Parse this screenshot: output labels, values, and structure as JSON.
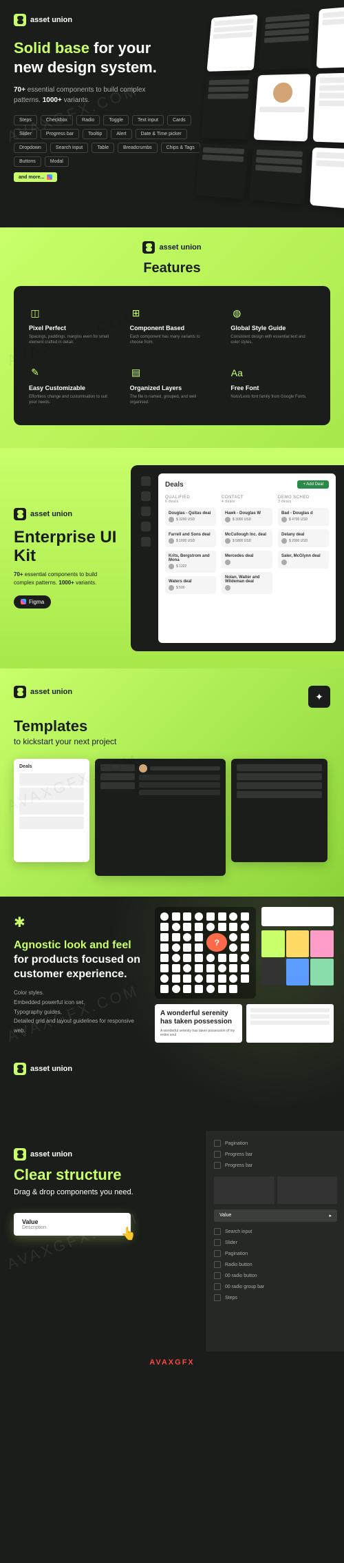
{
  "brand": "asset union",
  "watermark": "AVAXGFX.COM",
  "hero": {
    "title_accent": "Solid base",
    "title_rest": " for your new design system.",
    "sub_highlight1": "70+",
    "sub_text1": " essential components to build complex patterns. ",
    "sub_highlight2": "1000+",
    "sub_text2": " variants.",
    "tags": [
      "Steps",
      "Checkbox",
      "Radio",
      "Toggle",
      "Text input",
      "Cards",
      "Slider",
      "Progress bar",
      "Tooltip",
      "Alert",
      "Date & Time picker",
      "Dropdown",
      "Search input",
      "Table",
      "Breadcrumbs",
      "Chips & Tags",
      "Buttons",
      "Modal"
    ],
    "and_more": "and more..."
  },
  "features": {
    "title": "Features",
    "items": [
      {
        "icon": "◫",
        "name": "Pixel Perfect",
        "desc": "Spacings, paddings, margins even for small element crafted in detail."
      },
      {
        "icon": "⊞",
        "name": "Component Based",
        "desc": "Each component has many variants to choose from."
      },
      {
        "icon": "◍",
        "name": "Global Style Guide",
        "desc": "Consistent design with essential text and color styles."
      },
      {
        "icon": "✎",
        "name": "Easy Customizable",
        "desc": "Effortless change and customisation to suit your needs."
      },
      {
        "icon": "▤",
        "name": "Organized Layers",
        "desc": "The file is named, grouped, and well organised."
      },
      {
        "icon": "Aa",
        "name": "Free Font",
        "desc": "Noto/Lexis font family from Google Fonts."
      }
    ]
  },
  "enterprise": {
    "title": "Enterprise UI Kit",
    "sub_b1": "70+",
    "sub_t1": " essential components to build complex patterns. ",
    "sub_b2": "1000+",
    "sub_t2": " variants.",
    "figma": "Figma",
    "deals_title": "Deals",
    "add_deal": "+ Add Deal",
    "columns": [
      {
        "head": "QUALIFIED",
        "count": "6 deals",
        "deals": [
          {
            "name": "Douglas - Quitas deal",
            "amount": "$ 3200 USD"
          },
          {
            "name": "Farrell and Sons deal",
            "amount": "$ 1000 USD"
          },
          {
            "name": "Krits, Bergstrom and Mona",
            "amount": "$ 1222"
          },
          {
            "name": "Waters deal",
            "amount": "$ 500"
          }
        ]
      },
      {
        "head": "CONTACT",
        "count": "4 deals",
        "deals": [
          {
            "name": "Hawk - Douglas W",
            "amount": "$ 3000 USD"
          },
          {
            "name": "McCullough Inc. deal",
            "amount": "$ 5800 USD"
          },
          {
            "name": "Mercedes deal",
            "amount": ""
          },
          {
            "name": "Nolan, Walter and Wildeman deal",
            "amount": ""
          }
        ]
      },
      {
        "head": "DEMO SCHED",
        "count": "3 deals",
        "deals": [
          {
            "name": "Bad - Douglas d",
            "amount": "$ 4700 USD"
          },
          {
            "name": "Delany deal",
            "amount": "$ 2000 USD"
          },
          {
            "name": "Saler, McGlynn deal",
            "amount": ""
          }
        ]
      }
    ]
  },
  "templates": {
    "title": "Templates",
    "subtitle": "to kickstart your next project"
  },
  "agnostic": {
    "title_accent": "Agnostic look and feel",
    "title_rest": "for products focused on customer experience.",
    "bullets": [
      "Color styles.",
      "Embedded powerful icon set.",
      "Typography guides.",
      "Detailed grid and layout guidelines for responsive web."
    ],
    "typo_heading": "A wonderful serenity has taken possession",
    "typo_body": "A wonderful serenity has taken possession of my entire soul",
    "colors": [
      "#c8ff6a",
      "#ffd966",
      "#ff9cc8",
      "#333333",
      "#5a9cff",
      "#88ddaa"
    ]
  },
  "structure": {
    "title": "Clear structure",
    "subtitle": "Drag & drop components you need.",
    "drag_label": "Value",
    "drag_desc": "Description",
    "panel_items": [
      "Pagination",
      "Progress bar",
      "Progress bar"
    ],
    "panel_value": "Value",
    "panel_items2": [
      "Search input",
      "Slider",
      "Pagination",
      "Radio button",
      "00 radio button",
      "00 radio group bar",
      "Steps"
    ]
  },
  "bottom_brand_a": "AVAX",
  "bottom_brand_b": "GFX"
}
